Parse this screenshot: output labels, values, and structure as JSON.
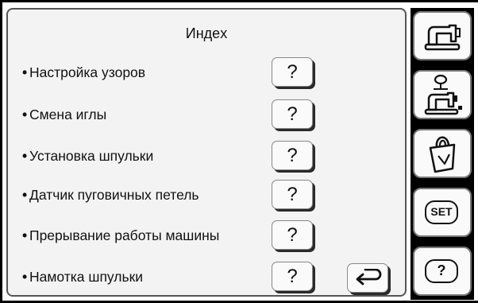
{
  "title": "Индex",
  "bullet": "•",
  "items": [
    {
      "label": "Настройка узоров",
      "help": "?"
    },
    {
      "label": "Смена иглы",
      "help": "?"
    },
    {
      "label": "Установка шпульки",
      "help": "?"
    },
    {
      "label": "Датчик пуговичных петель",
      "help": "?"
    },
    {
      "label": "Прерывание работы машины",
      "help": "?"
    },
    {
      "label": "Намотка шпульки",
      "help": "?"
    }
  ],
  "side": {
    "buttons": [
      {
        "icon": "sewing-machine-icon"
      },
      {
        "icon": "bobbin-winding-icon"
      },
      {
        "icon": "bag-icon"
      },
      {
        "icon": "set-icon",
        "label": "SET"
      },
      {
        "icon": "help-icon",
        "label": "?"
      }
    ]
  },
  "back_icon": "return-arrow-icon"
}
